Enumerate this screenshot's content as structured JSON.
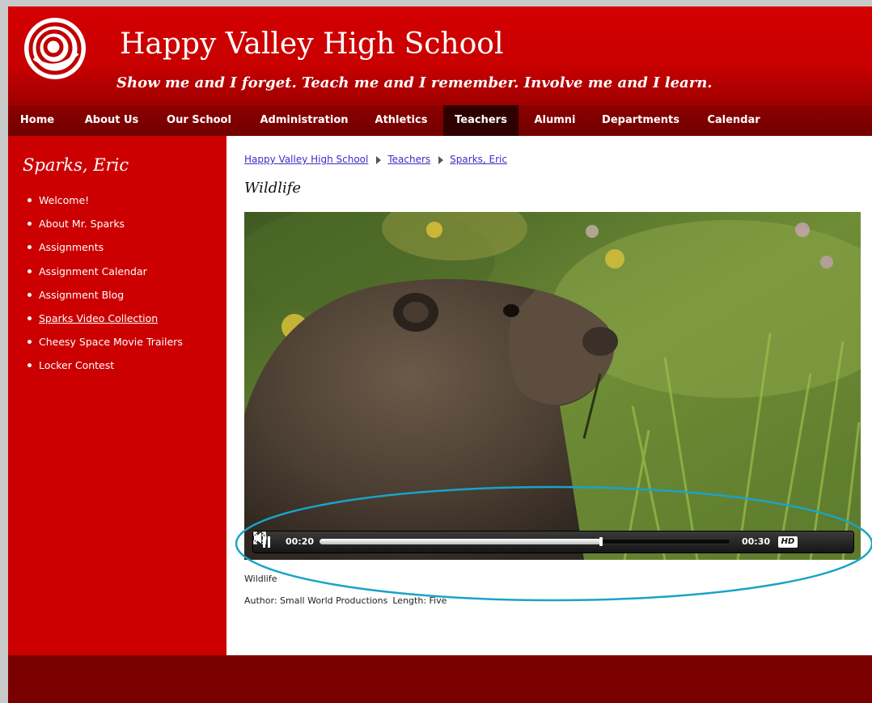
{
  "header": {
    "site_title": "Happy Valley High School",
    "tagline": "Show me and I forget. Teach me and I remember. Involve me and I learn."
  },
  "nav": {
    "items": [
      {
        "label": "Home"
      },
      {
        "label": "About Us"
      },
      {
        "label": "Our School"
      },
      {
        "label": "Administration"
      },
      {
        "label": "Athletics"
      },
      {
        "label": "Teachers",
        "active": true
      },
      {
        "label": "Alumni"
      },
      {
        "label": "Departments"
      },
      {
        "label": "Calendar"
      }
    ]
  },
  "sidebar": {
    "title": "Sparks, Eric",
    "items": [
      {
        "label": "Welcome!"
      },
      {
        "label": "About Mr. Sparks"
      },
      {
        "label": "Assignments"
      },
      {
        "label": "Assignment Calendar"
      },
      {
        "label": "Assignment Blog"
      },
      {
        "label": "Sparks Video Collection",
        "current": true
      },
      {
        "label": "Cheesy Space Movie Trailers"
      },
      {
        "label": "Locker Contest"
      }
    ]
  },
  "breadcrumb": {
    "items": [
      "Happy Valley High School",
      "Teachers",
      "Sparks, Eric"
    ]
  },
  "page": {
    "title": "Wildlife"
  },
  "video": {
    "current_time": "00:20",
    "duration": "00:30",
    "progress_fraction": 0.685,
    "hd_label": "HD"
  },
  "caption": {
    "title": "Wildlife",
    "author": "Author: Small World Productions",
    "length": "Length: Five"
  },
  "colors": {
    "brand_red": "#cc0000",
    "nav_dark": "#7a0000",
    "annotation_ring": "#1aa3c8"
  }
}
